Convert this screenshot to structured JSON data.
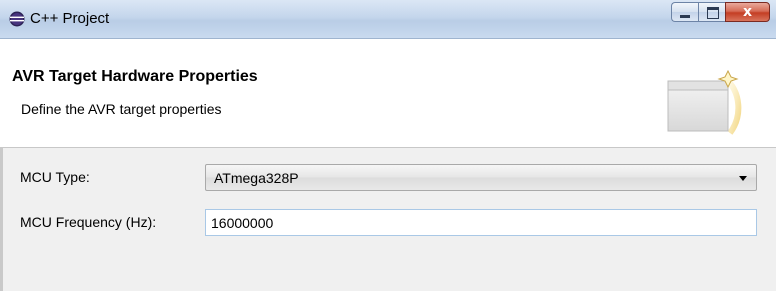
{
  "window": {
    "title": "C++ Project",
    "app_icon": "eclipse-icon",
    "controls": {
      "minimize": "minimize-icon",
      "maximize": "maximize-icon",
      "close": "x"
    }
  },
  "header": {
    "title": "AVR Target Hardware Properties",
    "description": "Define the AVR target properties",
    "graphic": "wizard-window-icon"
  },
  "form": {
    "mcu_type": {
      "label": "MCU Type:",
      "value": "ATmega328P"
    },
    "mcu_frequency": {
      "label": "MCU Frequency (Hz):",
      "value": "16000000"
    }
  },
  "colors": {
    "header_bg": "#ffffff",
    "body_bg": "#f0f0f0",
    "close_button": "#c43e24",
    "field_border": "#a9c8e6"
  }
}
